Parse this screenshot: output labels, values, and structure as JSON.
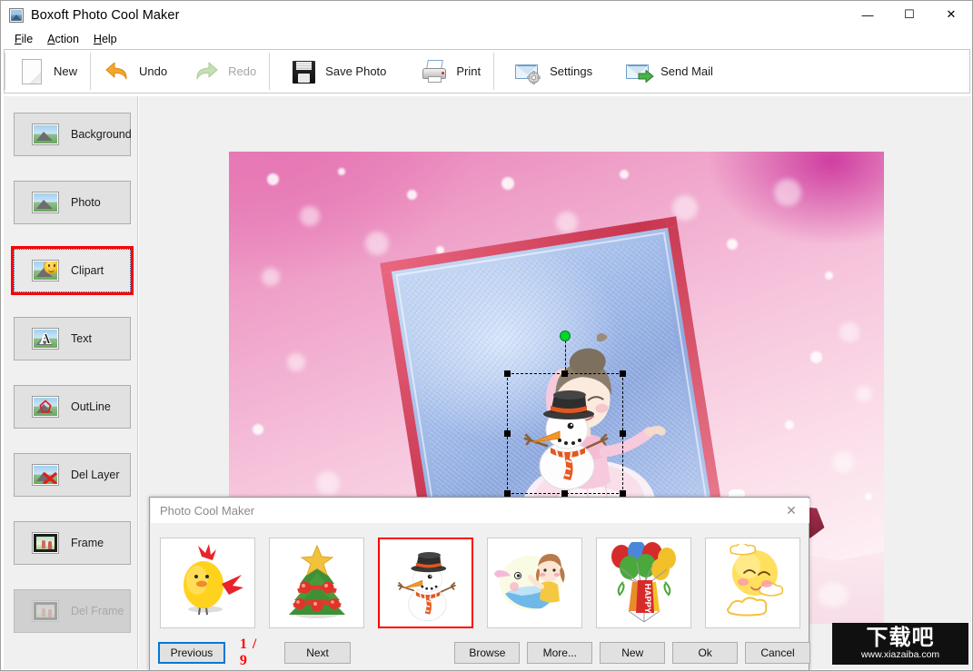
{
  "window": {
    "title": "Boxoft Photo Cool Maker",
    "app_icon": "photo-app-icon",
    "minimize": "—",
    "maximize": "☐",
    "close": "✕"
  },
  "menubar": {
    "items": [
      {
        "label": "File",
        "mnemonic": "F"
      },
      {
        "label": "Action",
        "mnemonic": "A"
      },
      {
        "label": "Help",
        "mnemonic": "H"
      }
    ]
  },
  "toolbar": {
    "groups": [
      {
        "buttons": [
          {
            "label": "New",
            "icon": "new-page-icon",
            "enabled": true
          }
        ]
      },
      {
        "buttons": [
          {
            "label": "Undo",
            "icon": "undo-arrow-icon",
            "enabled": true
          },
          {
            "label": "Redo",
            "icon": "redo-arrow-icon",
            "enabled": false
          }
        ]
      },
      {
        "buttons": [
          {
            "label": "Save Photo",
            "icon": "floppy-disk-icon",
            "enabled": true
          },
          {
            "label": "Print",
            "icon": "printer-icon",
            "enabled": true
          }
        ]
      },
      {
        "buttons": [
          {
            "label": "Settings",
            "icon": "envelope-gear-icon",
            "enabled": true
          },
          {
            "label": "Send Mail",
            "icon": "envelope-arrow-icon",
            "enabled": true
          }
        ]
      }
    ]
  },
  "sidebar": {
    "items": [
      {
        "label": "Background",
        "icon": "photo-thumbnail-icon",
        "state": "normal"
      },
      {
        "label": "Photo",
        "icon": "photo-thumbnail-icon",
        "state": "normal"
      },
      {
        "label": "Clipart",
        "icon": "photo-smiley-icon",
        "state": "selected"
      },
      {
        "label": "Text",
        "icon": "photo-letter-a-icon",
        "state": "normal"
      },
      {
        "label": "OutLine",
        "icon": "photo-outline-icon",
        "state": "normal"
      },
      {
        "label": "Del Layer",
        "icon": "photo-delete-x-icon",
        "state": "normal"
      },
      {
        "label": "Frame",
        "icon": "photo-frame-icon",
        "state": "normal"
      },
      {
        "label": "Del Frame",
        "icon": "photo-frame-icon",
        "state": "disabled"
      }
    ]
  },
  "canvas": {
    "description": "Pink bokeh photo of a ballerina illustration in a tilted blue frame with snow scenery",
    "selected_layer": "snowman-clipart",
    "selection": {
      "handles": 8,
      "rotation_handle_color": "#00d82b",
      "border_style": "dashed"
    }
  },
  "dialog": {
    "title": "Photo Cool Maker",
    "close_label": "✕",
    "page_indicator": "1  /  9",
    "page_current": 1,
    "page_total": 9,
    "thumbnails": [
      {
        "name": "chick-clipart",
        "selected": false
      },
      {
        "name": "christmas-tree-clipart",
        "selected": false
      },
      {
        "name": "snowman-clipart",
        "selected": true
      },
      {
        "name": "girl-bird-clipart",
        "selected": false
      },
      {
        "name": "happy-balloons-clipart",
        "selected": false,
        "banner_text": "HAPPY"
      },
      {
        "name": "moon-cloud-clipart",
        "selected": false
      }
    ],
    "buttons": [
      {
        "label": "Previous",
        "name": "previous-button",
        "focused": true
      },
      {
        "label": "Next",
        "name": "next-button",
        "focused": false
      },
      {
        "label": "Browse",
        "name": "browse-button",
        "focused": false
      },
      {
        "label": "More...",
        "name": "more-button",
        "focused": false
      },
      {
        "label": "New",
        "name": "new-button",
        "focused": false
      },
      {
        "label": "Ok",
        "name": "ok-button",
        "focused": false
      },
      {
        "label": "Cancel",
        "name": "cancel-button",
        "focused": false
      }
    ]
  },
  "watermark": {
    "chinese": "下载吧",
    "url": "www.xiazaiba.com"
  },
  "colors": {
    "accent_red": "#ff0000",
    "focus_blue": "#0078d7",
    "rotation_green": "#00d82b",
    "toolbar_bg": "#ffffff",
    "panel_bg": "#f0f0f0"
  }
}
